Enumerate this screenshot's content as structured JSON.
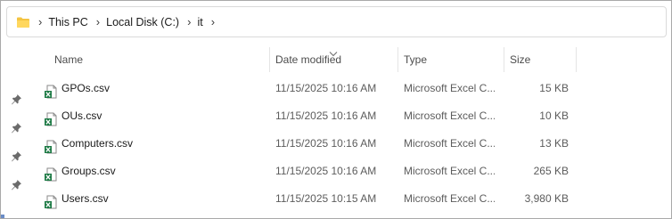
{
  "breadcrumb": {
    "items": [
      {
        "label": "This PC"
      },
      {
        "label": "Local Disk (C:)"
      },
      {
        "label": "it"
      }
    ]
  },
  "columns": {
    "name": "Name",
    "date": "Date modified",
    "type": "Type",
    "size": "Size"
  },
  "files": [
    {
      "name": "GPOs.csv",
      "date": "11/15/2025 10:16 AM",
      "type": "Microsoft Excel C...",
      "size": "15 KB"
    },
    {
      "name": "OUs.csv",
      "date": "11/15/2025 10:16 AM",
      "type": "Microsoft Excel C...",
      "size": "10 KB"
    },
    {
      "name": "Computers.csv",
      "date": "11/15/2025 10:16 AM",
      "type": "Microsoft Excel C...",
      "size": "13 KB"
    },
    {
      "name": "Groups.csv",
      "date": "11/15/2025 10:16 AM",
      "type": "Microsoft Excel C...",
      "size": "265 KB"
    },
    {
      "name": "Users.csv",
      "date": "11/15/2025 10:15 AM",
      "type": "Microsoft Excel C...",
      "size": "3,980 KB"
    }
  ],
  "colors": {
    "folder": "#f4c441",
    "excel": "#1d7a45",
    "pin": "#6b6b6b"
  },
  "icons": {
    "folder": "folder-icon",
    "file": "excel-csv-icon",
    "pin": "pin-icon"
  }
}
